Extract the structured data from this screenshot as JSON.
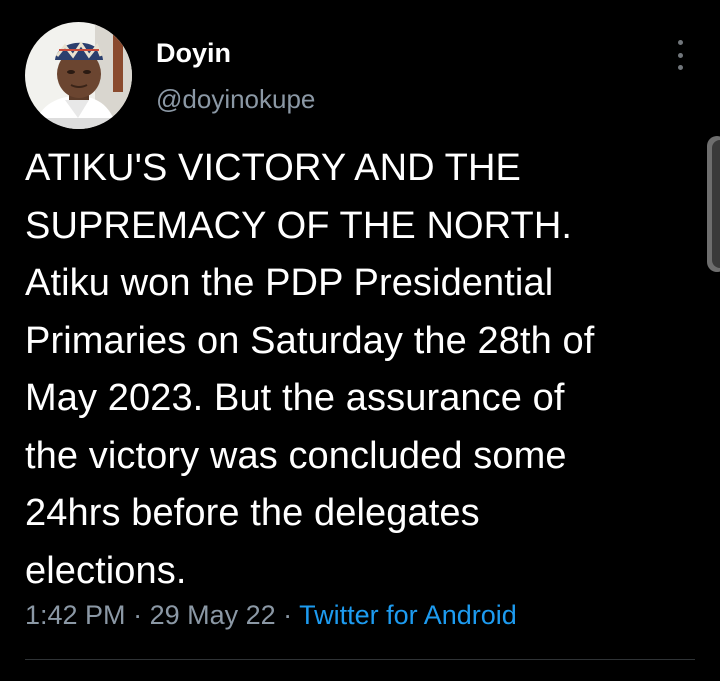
{
  "tweet": {
    "author": {
      "display_name": "Doyin",
      "handle": "@doyinokupe"
    },
    "text": "ATIKU'S VICTORY AND THE\nSUPREMACY OF THE NORTH.\n Atiku won the PDP Presidential\nPrimaries on Saturday the 28th of\nMay 2023. But the assurance of\nthe victory was concluded some\n24hrs before the delegates\nelections.",
    "time": "1:42 PM",
    "separator": " · ",
    "date": "29 May 22",
    "source": "Twitter for Android"
  },
  "icons": {
    "more": "more-vertical-icon"
  },
  "colors": {
    "background": "#000000",
    "text": "#ffffff",
    "secondary": "#8b98a5",
    "link": "#1d9bf0",
    "divider": "#2f3336"
  }
}
